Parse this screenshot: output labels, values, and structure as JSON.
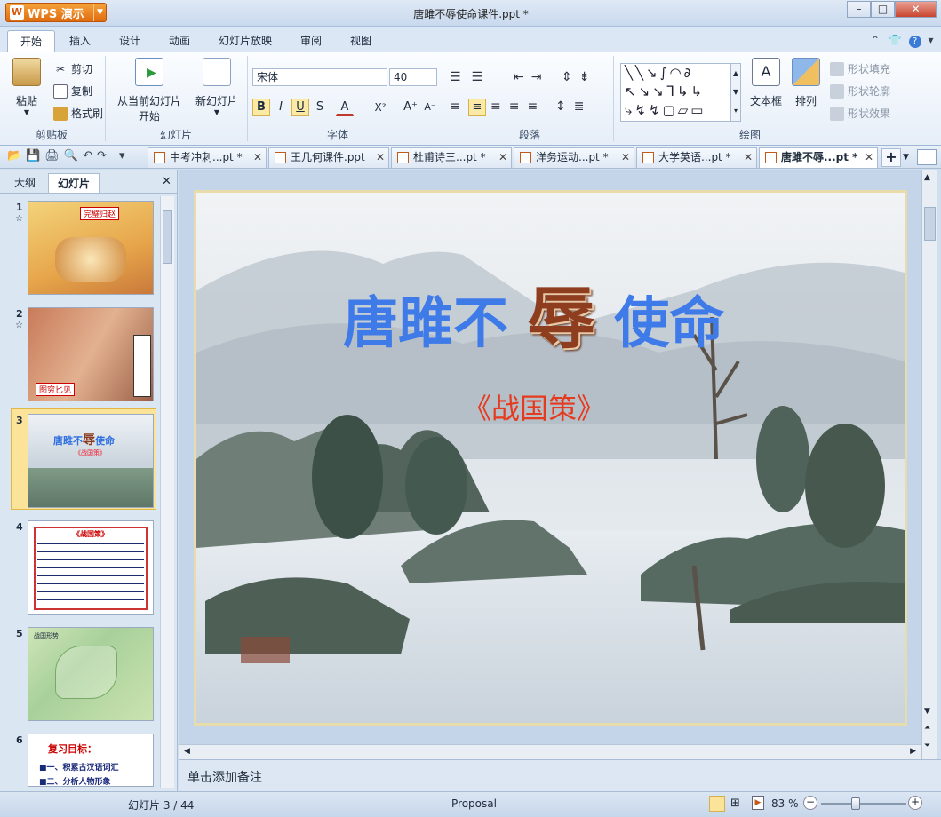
{
  "app": {
    "name": "WPS 演示",
    "window_title": "唐雎不辱使命课件.ppt *"
  },
  "ribbon_tabs": [
    "开始",
    "插入",
    "设计",
    "动画",
    "幻灯片放映",
    "审阅",
    "视图"
  ],
  "clipboard": {
    "paste": "粘贴",
    "cut": "剪切",
    "copy": "复制",
    "format_painter": "格式刷",
    "group": "剪贴板"
  },
  "slides_group": {
    "from_current": "从当前幻灯片",
    "start": "开始",
    "new_slide": "新幻灯片",
    "group": "幻灯片"
  },
  "font": {
    "name": "宋体",
    "size": "40",
    "group": "字体",
    "bold": "B",
    "italic": "I",
    "underline": "U",
    "shadow": "S",
    "color": "A",
    "superscript": "X²",
    "grow": "A⁺",
    "shrink": "A⁻"
  },
  "paragraph": {
    "group": "段落"
  },
  "drawing": {
    "textbox": "文本框",
    "arrange": "排列",
    "fill": "形状填充",
    "outline": "形状轮廓",
    "effect": "形状效果",
    "group": "绘图"
  },
  "doc_tabs": [
    {
      "label": "中考冲刺...pt *"
    },
    {
      "label": "王几何课件.ppt"
    },
    {
      "label": "杜甫诗三...pt *"
    },
    {
      "label": "洋务运动...pt *"
    },
    {
      "label": "大学英语...pt *"
    },
    {
      "label": "唐雎不辱...pt *"
    }
  ],
  "pane_tabs": {
    "outline": "大纲",
    "slides": "幻灯片"
  },
  "thumbnails": [
    {
      "num": "1",
      "star": "☆",
      "caption": "完璧归赵"
    },
    {
      "num": "2",
      "star": "☆",
      "caption": "图穷匕见"
    },
    {
      "num": "3",
      "title_a": "唐雎不",
      "title_b": "辱",
      "title_c": "使命",
      "sub": "《战国策》"
    },
    {
      "num": "4",
      "heading": "《战国策》"
    },
    {
      "num": "5",
      "heading": "战国形势"
    },
    {
      "num": "6",
      "heading": "复习目标：",
      "item1": "■一、积累古汉语词汇",
      "item2": "■二、分析人物形象"
    }
  ],
  "slide": {
    "title_a": "唐雎不",
    "title_b": "辱",
    "title_c": "使命",
    "subtitle": "《战国策》"
  },
  "notes_placeholder": "单击添加备注",
  "status": {
    "slide_counter": "幻灯片 3 / 44",
    "template": "Proposal",
    "zoom": "83 %"
  }
}
